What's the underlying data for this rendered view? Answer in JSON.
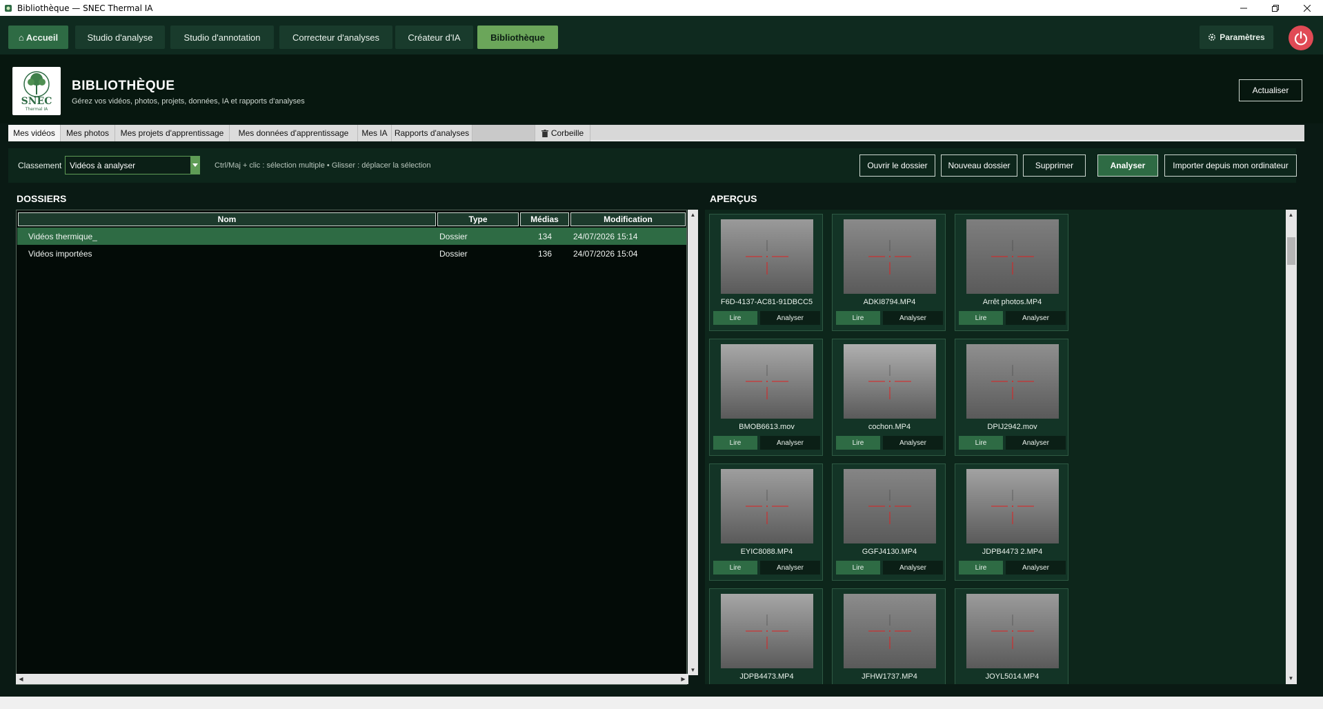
{
  "window": {
    "title": "Bibliothèque — SNEC Thermal IA"
  },
  "nav": {
    "home": "⌂ Accueil",
    "items": [
      "Studio d'analyse",
      "Studio d'annotation",
      "Correcteur d'analyses",
      "Créateur d'IA",
      "Bibliothèque"
    ],
    "settings": "Paramètres"
  },
  "header": {
    "title": "BIBLIOTHÈQUE",
    "subtitle": "Gérez vos vidéos, photos, projets, données, IA et rapports d'analyses",
    "refresh": "Actualiser",
    "logo_text": "SNEC",
    "logo_sub": "Thermal IA"
  },
  "tabs": [
    "Mes vidéos",
    "Mes photos",
    "Mes projets d'apprentissage",
    "Mes données d'apprentissage",
    "Mes IA",
    "Rapports d'analyses",
    "Corbeille"
  ],
  "toolbar": {
    "sort_label": "Classement",
    "sort_value": "Vidéos à analyser",
    "hint": "Ctrl/Maj + clic : sélection multiple • Glisser : déplacer la sélection",
    "open_folder": "Ouvrir le dossier",
    "new_folder": "Nouveau dossier",
    "delete": "Supprimer",
    "analyze": "Analyser",
    "import": "Importer depuis mon ordinateur"
  },
  "folders": {
    "title": "DOSSIERS",
    "columns": [
      "Nom",
      "Type",
      "Médias",
      "Modification"
    ],
    "rows": [
      {
        "name": "Vidéos thermique_",
        "type": "Dossier",
        "count": "134",
        "modified": "24/07/2026 15:14"
      },
      {
        "name": "Vidéos importées",
        "type": "Dossier",
        "count": "136",
        "modified": "24/07/2026 15:04"
      }
    ]
  },
  "previews": {
    "title": "APERÇUS",
    "play_label": "Lire",
    "analyze_label": "Analyser",
    "items": [
      {
        "name": "F6D-4137-AC81-91DBCC5"
      },
      {
        "name": "ADKI8794.MP4"
      },
      {
        "name": "Arrêt photos.MP4"
      },
      {
        "name": "BMOB6613.mov"
      },
      {
        "name": "cochon.MP4"
      },
      {
        "name": "DPIJ2942.mov"
      },
      {
        "name": "EYIC8088.MP4"
      },
      {
        "name": "GGFJ4130.MP4"
      },
      {
        "name": "JDPB4473 2.MP4"
      },
      {
        "name": "JDPB4473.MP4"
      },
      {
        "name": "JFHW1737.MP4"
      },
      {
        "name": "JOYL5014.MP4"
      }
    ]
  },
  "colors": {
    "accent": "#2e6b44",
    "active_tab": "#6ba65a",
    "power": "#e04a55",
    "background": "#0a1a14"
  }
}
